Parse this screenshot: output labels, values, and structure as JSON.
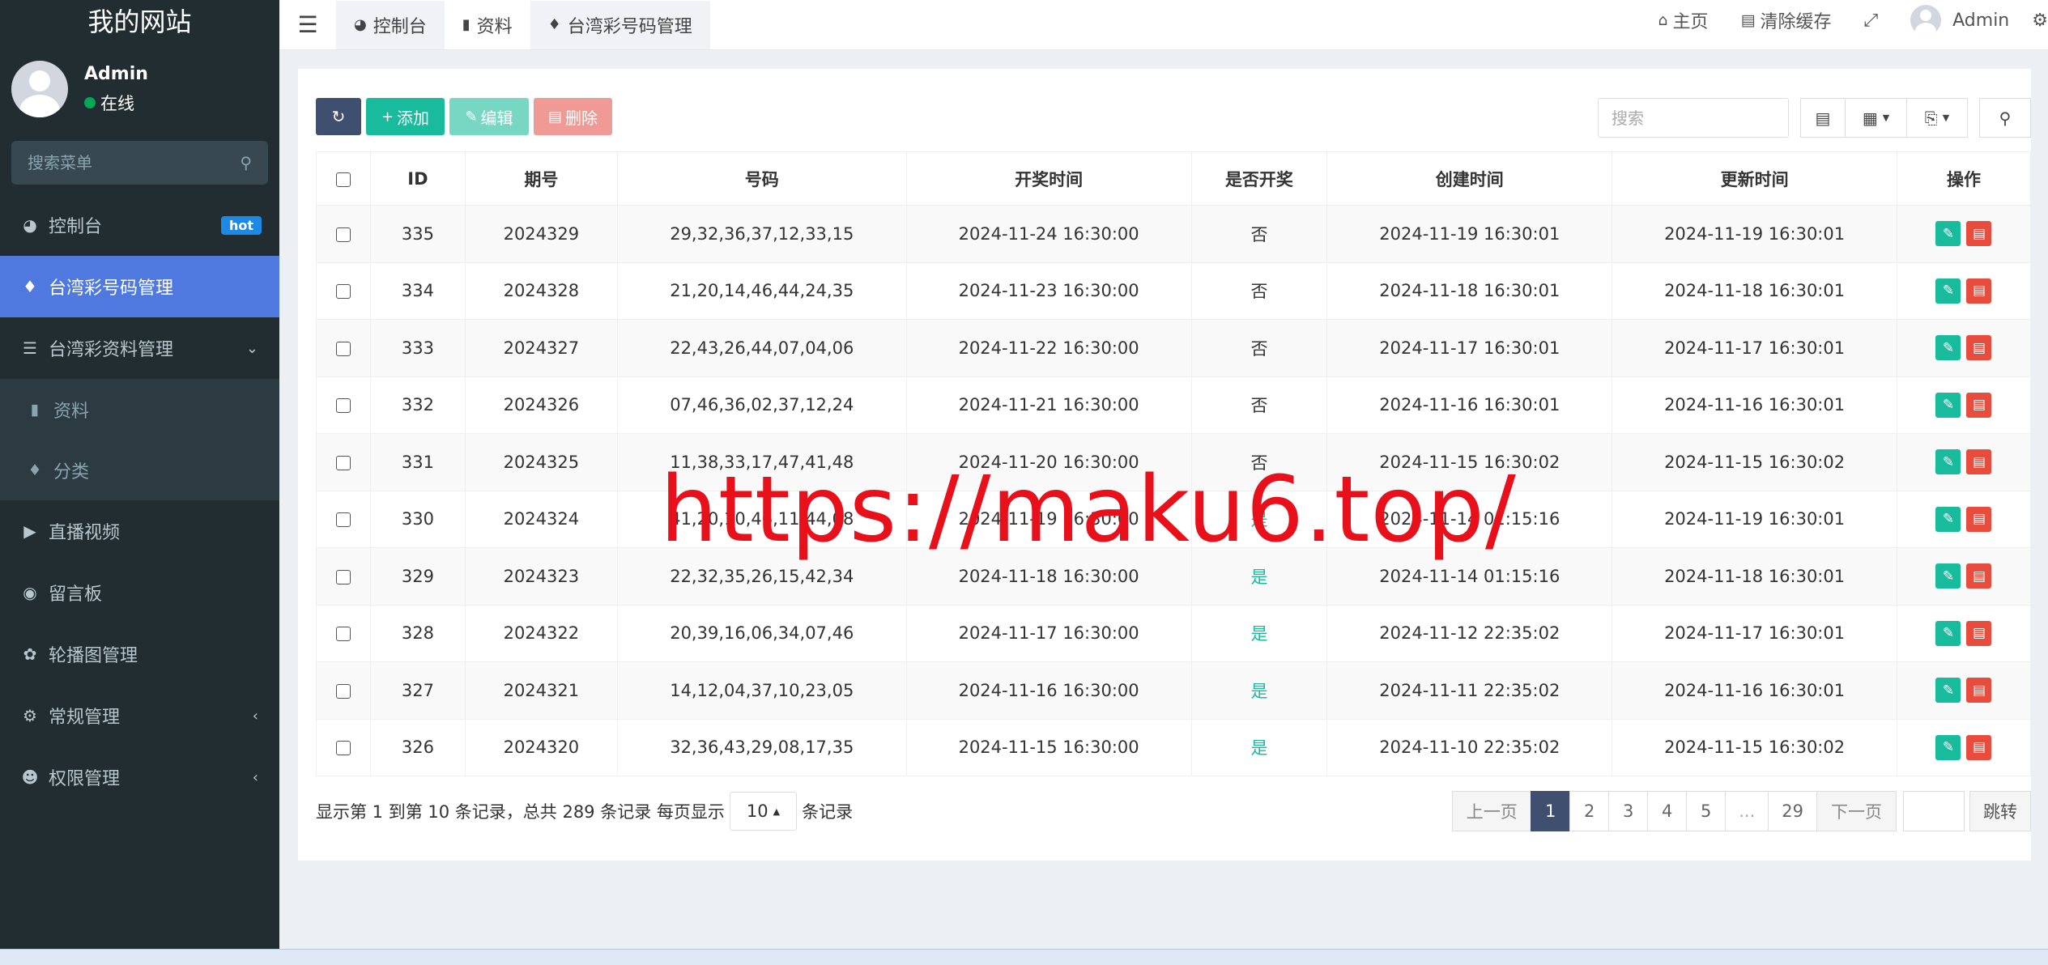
{
  "sidebar": {
    "brand": "我的网站",
    "user": {
      "name": "Admin",
      "status": "在线"
    },
    "search_placeholder": "搜索菜单",
    "items": [
      {
        "label": "控制台",
        "badge": "hot"
      },
      {
        "label": "台湾彩号码管理"
      },
      {
        "label": "台湾彩资料管理"
      },
      {
        "label": "资料"
      },
      {
        "label": "分类"
      },
      {
        "label": "直播视频"
      },
      {
        "label": "留言板"
      },
      {
        "label": "轮播图管理"
      },
      {
        "label": "常规管理"
      },
      {
        "label": "权限管理"
      }
    ]
  },
  "topbar": {
    "tabs": [
      "控制台",
      "资料",
      "台湾彩号码管理"
    ],
    "home": "主页",
    "clear_cache": "清除缓存",
    "admin": "Admin"
  },
  "toolbar": {
    "add": "添加",
    "edit": "编辑",
    "delete": "删除",
    "search_placeholder": "搜索"
  },
  "table": {
    "headers": [
      "ID",
      "期号",
      "号码",
      "开奖时间",
      "是否开奖",
      "创建时间",
      "更新时间",
      "操作"
    ],
    "rows": [
      [
        "335",
        "2024329",
        "29,32,36,37,12,33,15",
        "2024-11-24 16:30:00",
        "否",
        "2024-11-19 16:30:01",
        "2024-11-19 16:30:01"
      ],
      [
        "334",
        "2024328",
        "21,20,14,46,44,24,35",
        "2024-11-23 16:30:00",
        "否",
        "2024-11-18 16:30:01",
        "2024-11-18 16:30:01"
      ],
      [
        "333",
        "2024327",
        "22,43,26,44,07,04,06",
        "2024-11-22 16:30:00",
        "否",
        "2024-11-17 16:30:01",
        "2024-11-17 16:30:01"
      ],
      [
        "332",
        "2024326",
        "07,46,36,02,37,12,24",
        "2024-11-21 16:30:00",
        "否",
        "2024-11-16 16:30:01",
        "2024-11-16 16:30:01"
      ],
      [
        "331",
        "2024325",
        "11,38,33,17,47,41,48",
        "2024-11-20 16:30:00",
        "否",
        "2024-11-15 16:30:02",
        "2024-11-15 16:30:02"
      ],
      [
        "330",
        "2024324",
        "41,20,10,46,11,44,08",
        "2024-11-19 16:30:00",
        "是",
        "2024-11-14 01:15:16",
        "2024-11-19 16:30:01"
      ],
      [
        "329",
        "2024323",
        "22,32,35,26,15,42,34",
        "2024-11-18 16:30:00",
        "是",
        "2024-11-14 01:15:16",
        "2024-11-18 16:30:01"
      ],
      [
        "328",
        "2024322",
        "20,39,16,06,34,07,46",
        "2024-11-17 16:30:00",
        "是",
        "2024-11-12 22:35:02",
        "2024-11-17 16:30:01"
      ],
      [
        "327",
        "2024321",
        "14,12,04,37,10,23,05",
        "2024-11-16 16:30:00",
        "是",
        "2024-11-11 22:35:02",
        "2024-11-16 16:30:01"
      ],
      [
        "326",
        "2024320",
        "32,36,43,29,08,17,35",
        "2024-11-15 16:30:00",
        "是",
        "2024-11-10 22:35:02",
        "2024-11-15 16:30:02"
      ]
    ]
  },
  "footer": {
    "summary": "显示第 1 到第 10 条记录，总共 289 条记录 每页显示",
    "page_size": "10",
    "suffix": "条记录",
    "prev": "上一页",
    "pages": [
      "1",
      "2",
      "3",
      "4",
      "5",
      "...",
      "29"
    ],
    "next": "下一页",
    "jump": "跳转"
  },
  "watermark": "https://maku6.top/"
}
